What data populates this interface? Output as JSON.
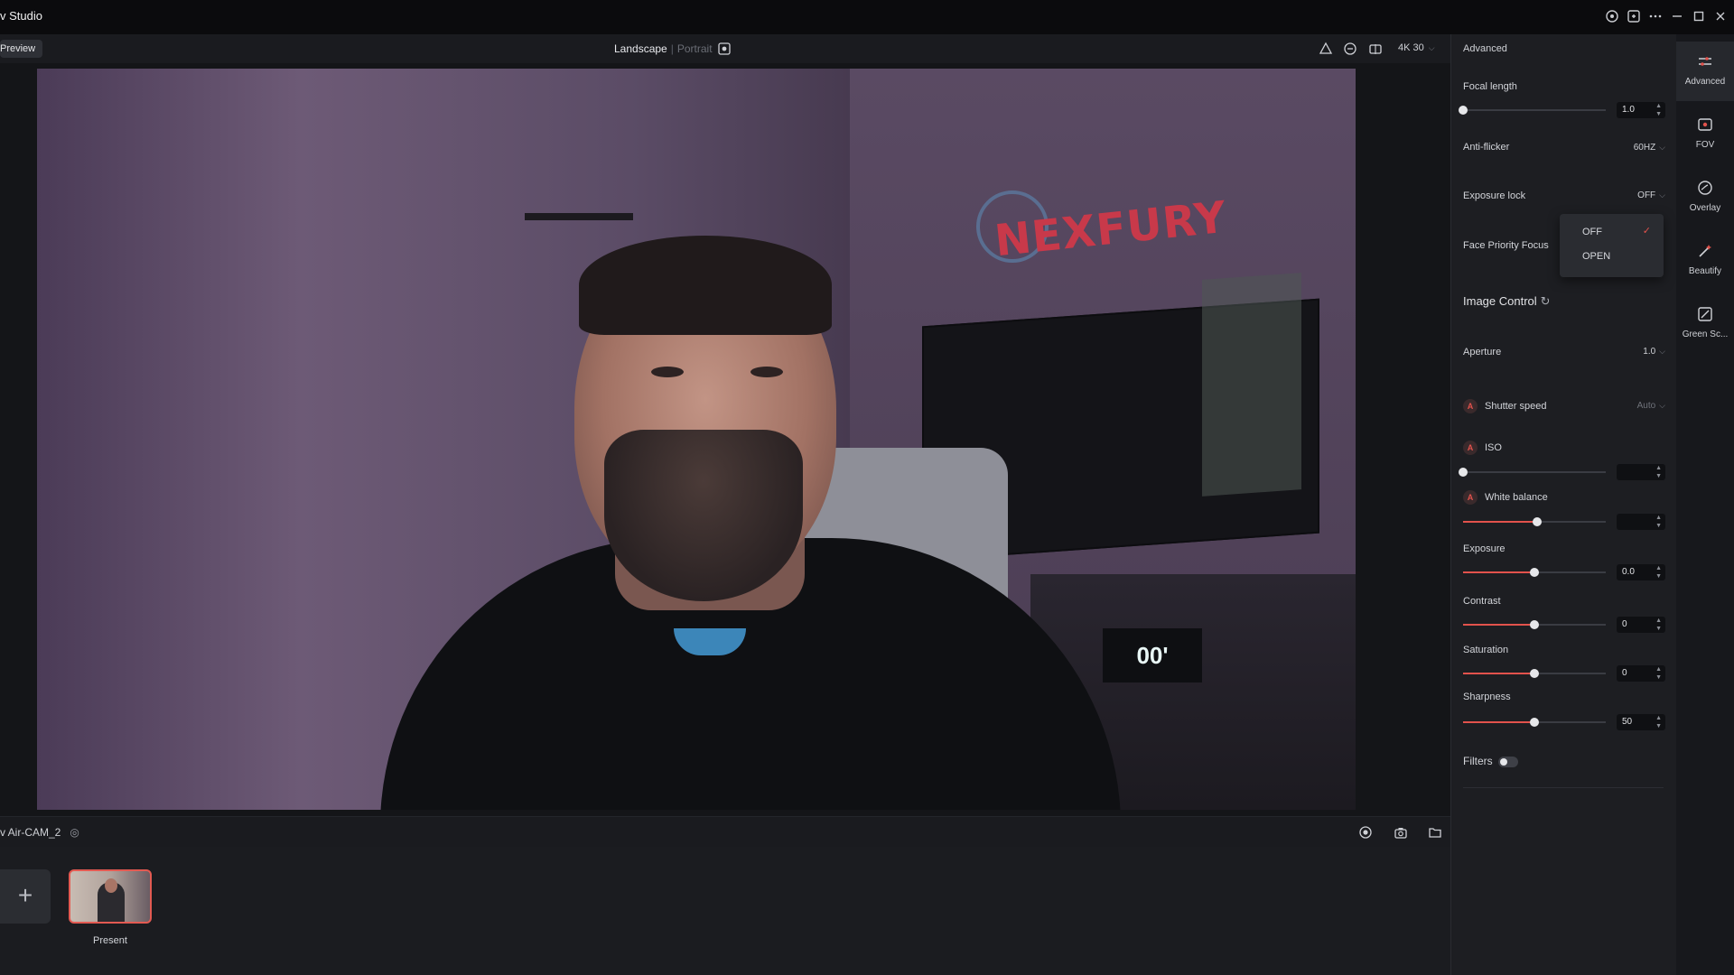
{
  "app": {
    "title": "v Studio"
  },
  "titlebar": {
    "icons": [
      "help-circle-icon",
      "feedback-icon",
      "more-icon",
      "minimize-icon",
      "maximize-icon",
      "close-icon"
    ]
  },
  "toolbar": {
    "preview_label": "Preview",
    "orientation_active": "Landscape",
    "orientation_separator": "|",
    "orientation_inactive": "Portrait",
    "resolution_label": "4K 30"
  },
  "camera": {
    "sign_text": "NEXFURY",
    "clock_text": "00'"
  },
  "source_bar": {
    "camera_name": "v Air-CAM_2"
  },
  "scenes": {
    "add_symbol": "+",
    "items": [
      {
        "label": "Present"
      }
    ]
  },
  "settings": {
    "title": "Advanced",
    "focal_length": {
      "label": "Focal length",
      "value": "1.0",
      "level": 0
    },
    "anti_flicker": {
      "label": "Anti-flicker",
      "value": "60HZ"
    },
    "exposure_lock": {
      "label": "Exposure lock",
      "value": "OFF"
    },
    "face_priority": {
      "label": "Face Priority Focus"
    },
    "image_control": {
      "label": "Image Control"
    },
    "aperture": {
      "label": "Aperture",
      "value": "1.0"
    },
    "shutter_speed": {
      "label": "Shutter speed",
      "value": "Auto",
      "badge": "A"
    },
    "iso": {
      "label": "ISO",
      "value": "",
      "level": 0,
      "badge": "A"
    },
    "white_balance": {
      "label": "White balance",
      "value": "",
      "level": 0.52,
      "badge": "A"
    },
    "exposure": {
      "label": "Exposure",
      "value": "0.0",
      "level": 0.5
    },
    "contrast": {
      "label": "Contrast",
      "value": "0",
      "level": 0.5
    },
    "saturation": {
      "label": "Saturation",
      "value": "0",
      "level": 0.5
    },
    "sharpness": {
      "label": "Sharpness",
      "value": "50",
      "level": 0.5
    },
    "filters": {
      "label": "Filters",
      "enabled": false
    }
  },
  "dropdown": {
    "options": [
      {
        "label": "OFF",
        "selected": true
      },
      {
        "label": "OPEN",
        "selected": false
      }
    ],
    "check_symbol": "✓"
  },
  "rail": {
    "items": [
      {
        "label": "Advanced",
        "icon": "sliders-icon",
        "active": true
      },
      {
        "label": "FOV",
        "icon": "fov-icon",
        "active": false
      },
      {
        "label": "Overlay",
        "icon": "overlay-icon",
        "active": false
      },
      {
        "label": "Beautify",
        "icon": "beautify-icon",
        "active": false
      },
      {
        "label": "Green Sc...",
        "icon": "green-screen-icon",
        "active": false
      }
    ]
  },
  "colors": {
    "accent": "#e2524c",
    "panel": "#1d1e22",
    "titlebar": "#0b0b0d"
  }
}
